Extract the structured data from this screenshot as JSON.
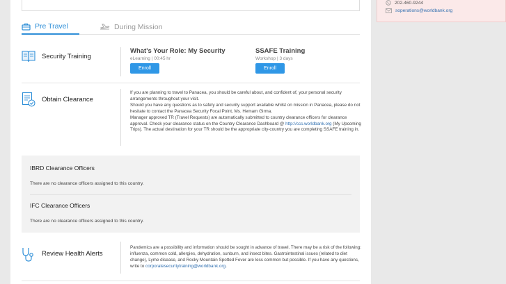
{
  "tabs": [
    {
      "label": "Pre Travel",
      "active": true
    },
    {
      "label": "During Mission",
      "active": false
    }
  ],
  "sidebar": {
    "phone": "202-460-9244",
    "email": "soperations@worldbank.org"
  },
  "security_training": {
    "title": "Security Training",
    "courses": [
      {
        "title": "What's Your Role: My Security",
        "meta": "eLearning | 00:45 hr",
        "button": "Enroll"
      },
      {
        "title": "SSAFE Training",
        "meta": "Workshop | 3 days",
        "button": "Enroll"
      }
    ]
  },
  "obtain_clearance": {
    "title": "Obtain Clearance",
    "line1": "If you are planning to travel to Panacea, you should be careful about, and confident of, your personal security arrangements throughout your visit.",
    "line2": "Should you have any questions as to safety and security support available whilst on mission in Panacea, please do not hesitate to contact the Panacea Security Focal Point, Ms. Hemam Girma.",
    "line3a": "Manager approved TR (Travel Requests) are automatically submitted to country clearance officers for clearance approval. Check your clearance status on the Country Clearance Dashboard @ ",
    "link": "http://ccs.worldbank.org",
    "line3b": " (My Upcoming Trips). The actual destination for your TR should be the appropriate city-country you are completing SSAFE training in."
  },
  "clearance_officers": [
    {
      "title": "IBRD Clearance Officers",
      "text": "There are no clearance officers assigned to this country."
    },
    {
      "title": "IFC Clearance Officers",
      "text": "There are no clearance officers assigned to this country."
    }
  ],
  "health_alerts": {
    "title": "Review Health Alerts",
    "text": "Pandemics are a possibility and information should be sought in advance of travel. There may be a risk of the following: influenza, common cold, allergies, dehydration, sunburn, and insect bites. Gastrointestinal issues (related to diet change), Lyme disease, and Rocky Mountain Spotted Fever are less common but possible. If you have any questions, write to ",
    "link": "corporatesecuritytraining@worldbank.org",
    "end": "."
  },
  "colors": {
    "accent": "#2f8fd8",
    "button": "#2f97e6",
    "sidebar_bg": "#fbe9e9",
    "gray_box": "#f2f2f2"
  },
  "icons": [
    "briefcase-icon",
    "plane-icon",
    "book-icon",
    "clipboard-check-icon",
    "stethoscope-icon",
    "phone-icon",
    "mail-icon"
  ]
}
